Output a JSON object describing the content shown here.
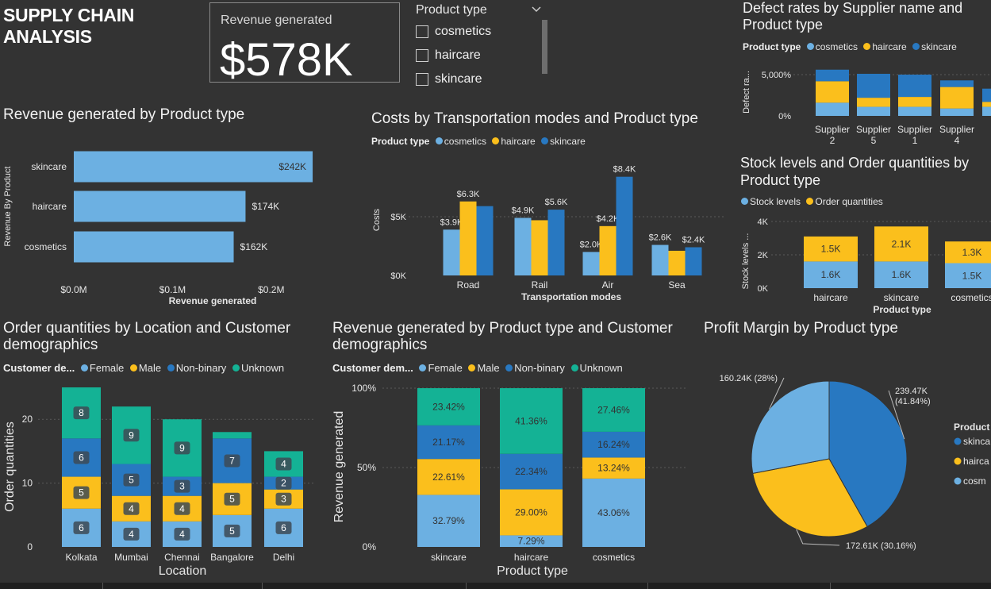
{
  "header": {
    "title_line1": "SUPPLY CHAIN",
    "title_line2": "ANALYSIS"
  },
  "kpi": {
    "label": "Revenue generated",
    "value": "$578K"
  },
  "slicer": {
    "title": "Product type",
    "options": [
      "cosmetics",
      "haircare",
      "skincare"
    ]
  },
  "colors": {
    "cosmetics": "#6cb0e2",
    "haircare": "#fbbf1c",
    "skincare": "#2878c1",
    "female": "#6cb0e2",
    "male": "#fbbf1c",
    "nonbinary": "#2878c1",
    "unknown": "#14b295",
    "background": "#333333"
  },
  "icons": {
    "slicer_toggle": "chevron-down-icon"
  },
  "chart_data": [
    {
      "id": "revenue_by_product",
      "type": "bar",
      "orientation": "horizontal",
      "title": "Revenue generated by Product type",
      "xlabel": "Revenue generated",
      "ylabel": "Revenue By Product",
      "categories": [
        "skincare",
        "haircare",
        "cosmetics"
      ],
      "values": [
        242000,
        174000,
        162000
      ],
      "data_labels": [
        "$242K",
        "$174K",
        "$162K"
      ],
      "x_ticks": [
        "$0.0M",
        "$0.1M",
        "$0.2M"
      ],
      "xlim": [
        0,
        250000
      ]
    },
    {
      "id": "costs_by_transport",
      "type": "bar",
      "title": "Costs by Transportation modes and Product type",
      "xlabel": "Transportation modes",
      "ylabel": "Costs",
      "legend_title": "Product type",
      "categories": [
        "Road",
        "Rail",
        "Air",
        "Sea"
      ],
      "series": [
        {
          "name": "cosmetics",
          "values": [
            3.9,
            4.9,
            2.0,
            2.6
          ],
          "labels": [
            "$3.9K",
            "$4.9K",
            "$2.0K",
            "$2.6K"
          ]
        },
        {
          "name": "haircare",
          "values": [
            6.3,
            4.7,
            4.2,
            2.1
          ],
          "labels": [
            "$6.3K",
            "",
            "$4.2K",
            ""
          ]
        },
        {
          "name": "skincare",
          "values": [
            5.9,
            5.6,
            8.4,
            2.4
          ],
          "labels": [
            "",
            "$5.6K",
            "$8.4K",
            "$2.4K"
          ]
        }
      ],
      "y_ticks": [
        "$0K",
        "$5K"
      ],
      "ylim": [
        0,
        10
      ]
    },
    {
      "id": "defect_rates",
      "type": "bar",
      "stacked": true,
      "title": "Defect rates by Supplier name and Product type",
      "ylabel": "Defect ra...",
      "legend_title": "Product type",
      "categories": [
        "Supplier 2",
        "Supplier 5",
        "Supplier 1",
        "Supplier 4",
        "Su"
      ],
      "category_lines": [
        [
          "Supplier",
          "2"
        ],
        [
          "Supplier",
          "5"
        ],
        [
          "Supplier",
          "1"
        ],
        [
          "Supplier",
          "4"
        ],
        [
          "Su",
          ""
        ]
      ],
      "series": [
        {
          "name": "cosmetics",
          "values": [
            1600,
            1100,
            1100,
            900,
            1100
          ]
        },
        {
          "name": "haircare",
          "values": [
            2600,
            1100,
            1200,
            2600,
            600
          ]
        },
        {
          "name": "skincare",
          "values": [
            1400,
            2900,
            2700,
            800,
            1600
          ]
        }
      ],
      "y_ticks": [
        "0%",
        "5,000%"
      ],
      "ylim": [
        0,
        6000
      ]
    },
    {
      "id": "stock_order",
      "type": "bar",
      "stacked": true,
      "title": "Stock levels and Order quantities by Product type",
      "xlabel": "Product type",
      "ylabel": "Stock levels ...",
      "categories": [
        "haircare",
        "skincare",
        "cosmetics"
      ],
      "series": [
        {
          "name": "Stock levels",
          "values": [
            1600,
            1600,
            1500
          ],
          "labels": [
            "1.6K",
            "1.6K",
            "1.5K"
          ]
        },
        {
          "name": "Order quantities",
          "values": [
            1500,
            2100,
            1300
          ],
          "labels": [
            "1.5K",
            "2.1K",
            "1.3K"
          ]
        }
      ],
      "y_ticks": [
        "0K",
        "2K",
        "4K"
      ],
      "ylim": [
        0,
        4000
      ]
    },
    {
      "id": "order_by_location",
      "type": "bar",
      "stacked": true,
      "title": "Order quantities by Location and Customer demographics",
      "xlabel": "Location",
      "ylabel": "Order quantities",
      "legend_title": "Customer de...",
      "categories": [
        "Kolkata",
        "Mumbai",
        "Chennai",
        "Bangalore",
        "Delhi"
      ],
      "series": [
        {
          "name": "Female",
          "values": [
            6,
            4,
            4,
            5,
            6
          ]
        },
        {
          "name": "Male",
          "values": [
            5,
            4,
            4,
            5,
            3
          ]
        },
        {
          "name": "Non-binary",
          "values": [
            6,
            5,
            3,
            7,
            2
          ]
        },
        {
          "name": "Unknown",
          "values": [
            8,
            9,
            9,
            1,
            4
          ]
        }
      ],
      "y_ticks": [
        "0",
        "10",
        "20"
      ],
      "ylim": [
        0,
        25
      ]
    },
    {
      "id": "revenue_by_demographics",
      "type": "bar",
      "stacked": true,
      "percent": true,
      "title": "Revenue generated by Product type and Customer demographics",
      "xlabel": "Product type",
      "ylabel": "Revenue generated",
      "legend_title": "Customer dem...",
      "categories": [
        "skincare",
        "haircare",
        "cosmetics"
      ],
      "series": [
        {
          "name": "Female",
          "values": [
            32.79,
            7.29,
            43.06
          ],
          "labels": [
            "32.79%",
            "7.29%",
            "43.06%"
          ]
        },
        {
          "name": "Male",
          "values": [
            22.61,
            29.0,
            13.24
          ],
          "labels": [
            "22.61%",
            "29.00%",
            "13.24%"
          ]
        },
        {
          "name": "Non-binary",
          "values": [
            21.17,
            22.34,
            16.24
          ],
          "labels": [
            "21.17%",
            "22.34%",
            "16.24%"
          ]
        },
        {
          "name": "Unknown",
          "values": [
            23.42,
            41.36,
            27.46
          ],
          "labels": [
            "23.42%",
            "41.36%",
            "27.46%"
          ]
        }
      ],
      "y_ticks": [
        "0%",
        "50%",
        "100%"
      ],
      "ylim": [
        0,
        100
      ]
    },
    {
      "id": "profit_margin",
      "type": "pie",
      "title": "Profit Margin by Product type",
      "legend_title": "Product",
      "legend_entries": [
        "skinca",
        "hairca",
        "cosm"
      ],
      "slices": [
        {
          "name": "skincare",
          "value": 239.47,
          "label_line1": "239.47K",
          "label_line2": "(41.84%)"
        },
        {
          "name": "haircare",
          "value": 172.61,
          "label_line1": "172.61K (30.16%)",
          "label_line2": ""
        },
        {
          "name": "cosmetics",
          "value": 160.24,
          "label_line1": "160.24K (28%)",
          "label_line2": ""
        }
      ]
    }
  ]
}
